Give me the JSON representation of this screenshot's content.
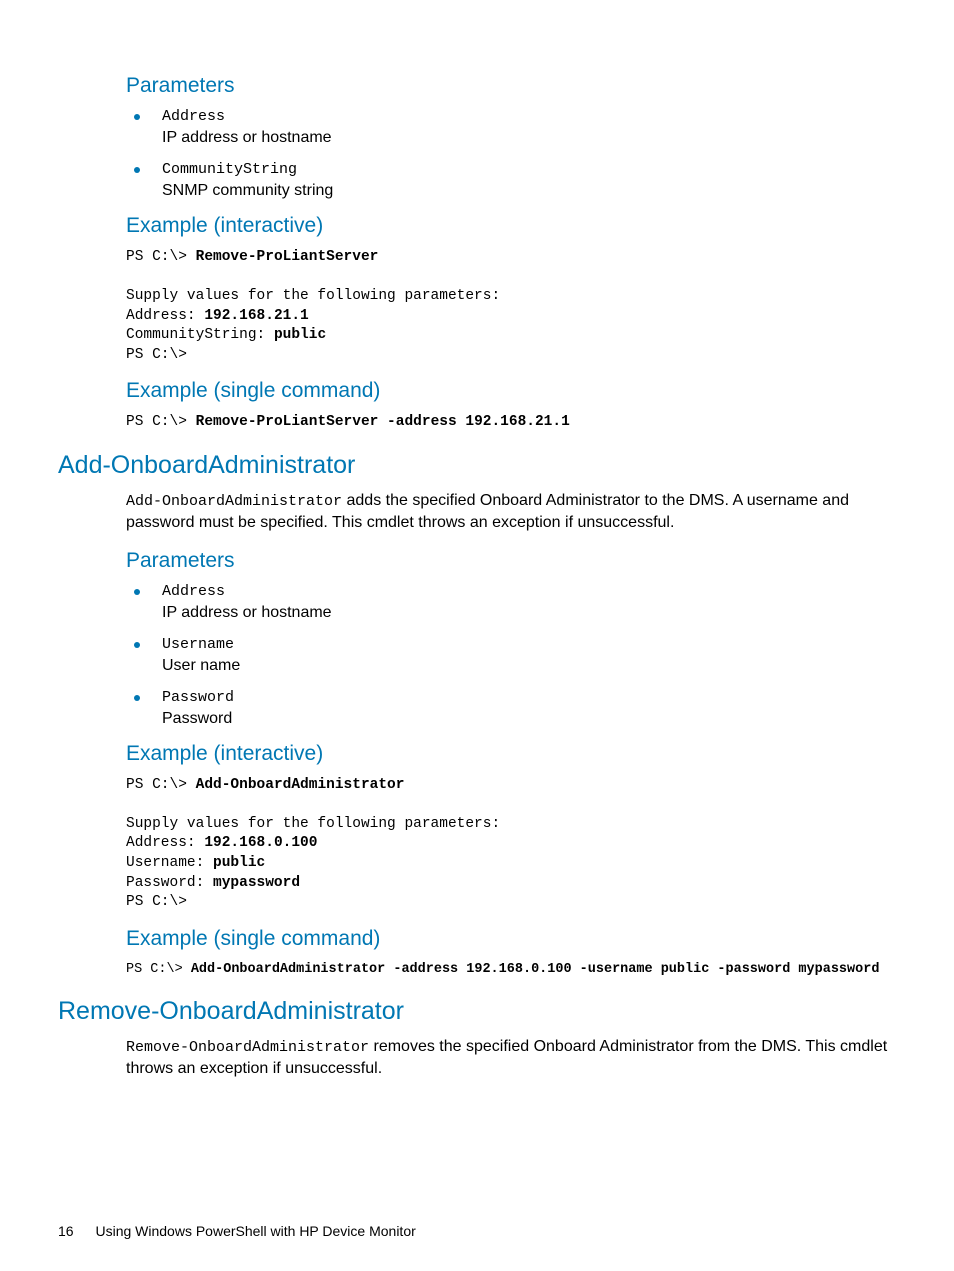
{
  "section1": {
    "parameters_heading": "Parameters",
    "params": [
      {
        "name": "Address",
        "desc": "IP address or hostname"
      },
      {
        "name": "CommunityString",
        "desc": "SNMP community string"
      }
    ],
    "example_interactive_heading": "Example (interactive)",
    "interactive_code": {
      "line1_prefix": "PS C:\\> ",
      "line1_cmd": "Remove-ProLiantServer",
      "line2": "Supply values for the following parameters:",
      "line3_prefix": "Address: ",
      "line3_val": "192.168.21.1",
      "line4_prefix": "CommunityString: ",
      "line4_val": "public",
      "line5": "PS C:\\>"
    },
    "example_single_heading": "Example (single command)",
    "single_prefix": "PS C:\\> ",
    "single_cmd": "Remove-ProLiantServer -address 192.168.21.1"
  },
  "section2": {
    "title": "Add-OnboardAdministrator",
    "desc_mono": "Add-OnboardAdministrator",
    "desc_rest": " adds the specified Onboard Administrator to the DMS. A username and password must be specified. This cmdlet throws an exception if unsuccessful.",
    "parameters_heading": "Parameters",
    "params": [
      {
        "name": "Address",
        "desc": "IP address or hostname"
      },
      {
        "name": "Username",
        "desc": "User name"
      },
      {
        "name": "Password",
        "desc": "Password"
      }
    ],
    "example_interactive_heading": "Example (interactive)",
    "interactive_code": {
      "line1_prefix": "PS C:\\> ",
      "line1_cmd": "Add-OnboardAdministrator",
      "line2": "Supply values for the following parameters:",
      "line3_prefix": "Address: ",
      "line3_val": "192.168.0.100",
      "line4_prefix": "Username: ",
      "line4_val": "public",
      "line5_prefix": "Password: ",
      "line5_val": "mypassword",
      "line6": "PS C:\\>"
    },
    "example_single_heading": "Example (single command)",
    "single_prefix": "PS C:\\> ",
    "single_cmd": "Add-OnboardAdministrator -address 192.168.0.100 -username public -password mypassword"
  },
  "section3": {
    "title": "Remove-OnboardAdministrator",
    "desc_mono": "Remove-OnboardAdministrator",
    "desc_rest": " removes the specified Onboard Administrator from the DMS. This cmdlet throws an exception if unsuccessful."
  },
  "footer": {
    "page": "16",
    "title": "Using Windows PowerShell with HP Device Monitor"
  }
}
